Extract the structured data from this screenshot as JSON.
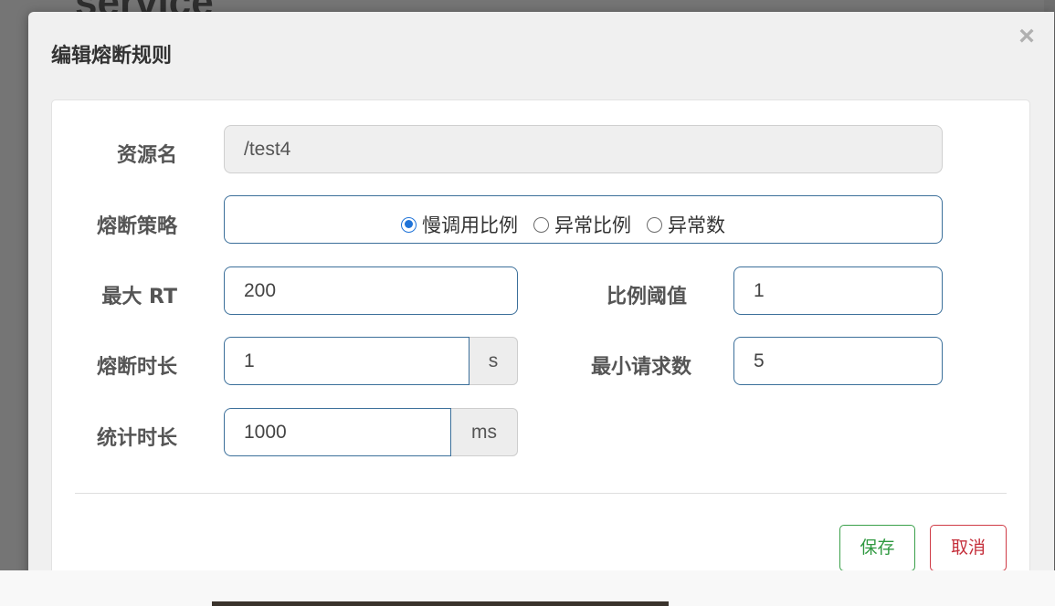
{
  "background": {
    "title": "service"
  },
  "modal": {
    "title": "编辑熔断规则",
    "close_symbol": "×"
  },
  "form": {
    "resource_label": "资源名",
    "resource_value": "/test4",
    "strategy_label": "熔断策略",
    "strategy_options": [
      {
        "label": "慢调用比例",
        "checked": true
      },
      {
        "label": "异常比例",
        "checked": false
      },
      {
        "label": "异常数",
        "checked": false
      }
    ],
    "max_rt_label": "最大 RT",
    "max_rt_value": "200",
    "ratio_label": "比例阈值",
    "ratio_value": "1",
    "duration_label": "熔断时长",
    "duration_value": "1",
    "duration_unit": "s",
    "min_request_label": "最小请求数",
    "min_request_value": "5",
    "stat_label": "统计时长",
    "stat_value": "1000",
    "stat_unit": "ms"
  },
  "footer": {
    "save_label": "保存",
    "cancel_label": "取消"
  },
  "colors": {
    "save": "#2f9940",
    "cancel": "#c5303c",
    "input_border": "#3b6f9a",
    "radio_checked": "#1f73d8"
  }
}
